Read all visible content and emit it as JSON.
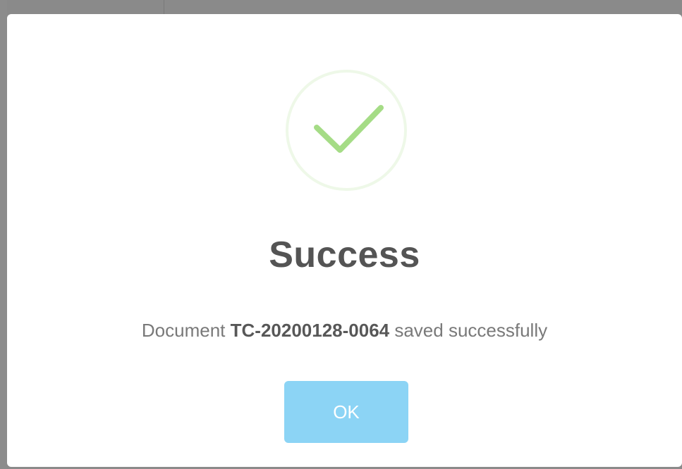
{
  "dialog": {
    "title": "Success",
    "message_prefix": "Document ",
    "document_id": "TC-20200128-0064",
    "message_suffix": " saved successfully",
    "ok_label": "OK",
    "icon": "checkmark-circle-icon"
  },
  "colors": {
    "success_green": "#a5dc86",
    "success_ring": "#eef8e8",
    "button_bg": "#8cd4f5",
    "title_text": "#545454",
    "message_text": "#797979"
  }
}
